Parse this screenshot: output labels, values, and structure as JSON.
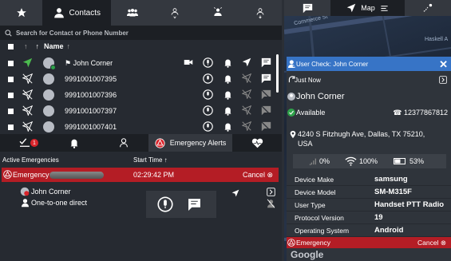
{
  "top_tabs": [
    {
      "icon": "star-icon",
      "label": ""
    },
    {
      "icon": "contacts-icon",
      "label": "Contacts"
    },
    {
      "icon": "groups-icon",
      "label": ""
    },
    {
      "icon": "incoming-call-group-icon",
      "label": ""
    },
    {
      "icon": "broadcast-group-icon",
      "label": ""
    },
    {
      "icon": "download-group-icon",
      "label": ""
    }
  ],
  "search": {
    "placeholder": "Search for Contact or Phone Number"
  },
  "list_header": {
    "name_label": "Name"
  },
  "contacts": [
    {
      "name": "John Corner",
      "available": true,
      "has_video": true
    },
    {
      "name": "9991001007395",
      "available": false,
      "has_video": false
    },
    {
      "name": "9991001007396",
      "available": false,
      "has_video": false
    },
    {
      "name": "9991001007397",
      "available": false,
      "has_video": false
    },
    {
      "name": "9991001007401",
      "available": false,
      "has_video": false
    }
  ],
  "bottom_tabs": {
    "alerts_badge": "1",
    "emergency_label": "Emergency Alerts"
  },
  "emergencies": {
    "col_active": "Active Emergencies",
    "col_start": "Start Time",
    "row": {
      "label": "Emergency",
      "time": "02:29:42 PM",
      "cancel": "Cancel"
    },
    "user": "John Corner",
    "call_type": "One-to-one direct"
  },
  "right_tabs": {
    "map_label": "Map"
  },
  "map_labels": {
    "street": "Commerce St",
    "area": "Haskell A",
    "brand": "Google"
  },
  "user_check": {
    "title": "User Check: John Corner",
    "when": "Just Now",
    "name": "John Corner",
    "status": "Available",
    "phone": "12377867812",
    "address": "4240 S Fitzhugh Ave, Dallas, TX 75210, USA",
    "signal": "0%",
    "wifi": "100%",
    "battery": "53%",
    "details": [
      {
        "key": "Device Make",
        "value": "samsung"
      },
      {
        "key": "Device Model",
        "value": "SM-M315F"
      },
      {
        "key": "User Type",
        "value": "Handset PTT Radio"
      },
      {
        "key": "Protocol Version",
        "value": "19"
      },
      {
        "key": "Operating System",
        "value": "Android"
      }
    ],
    "emergency_label": "Emergency",
    "cancel": "Cancel"
  },
  "colors": {
    "accent_blue": "#3774c6",
    "emergency_red": "#b41d25",
    "available_green": "#2ea14a"
  }
}
